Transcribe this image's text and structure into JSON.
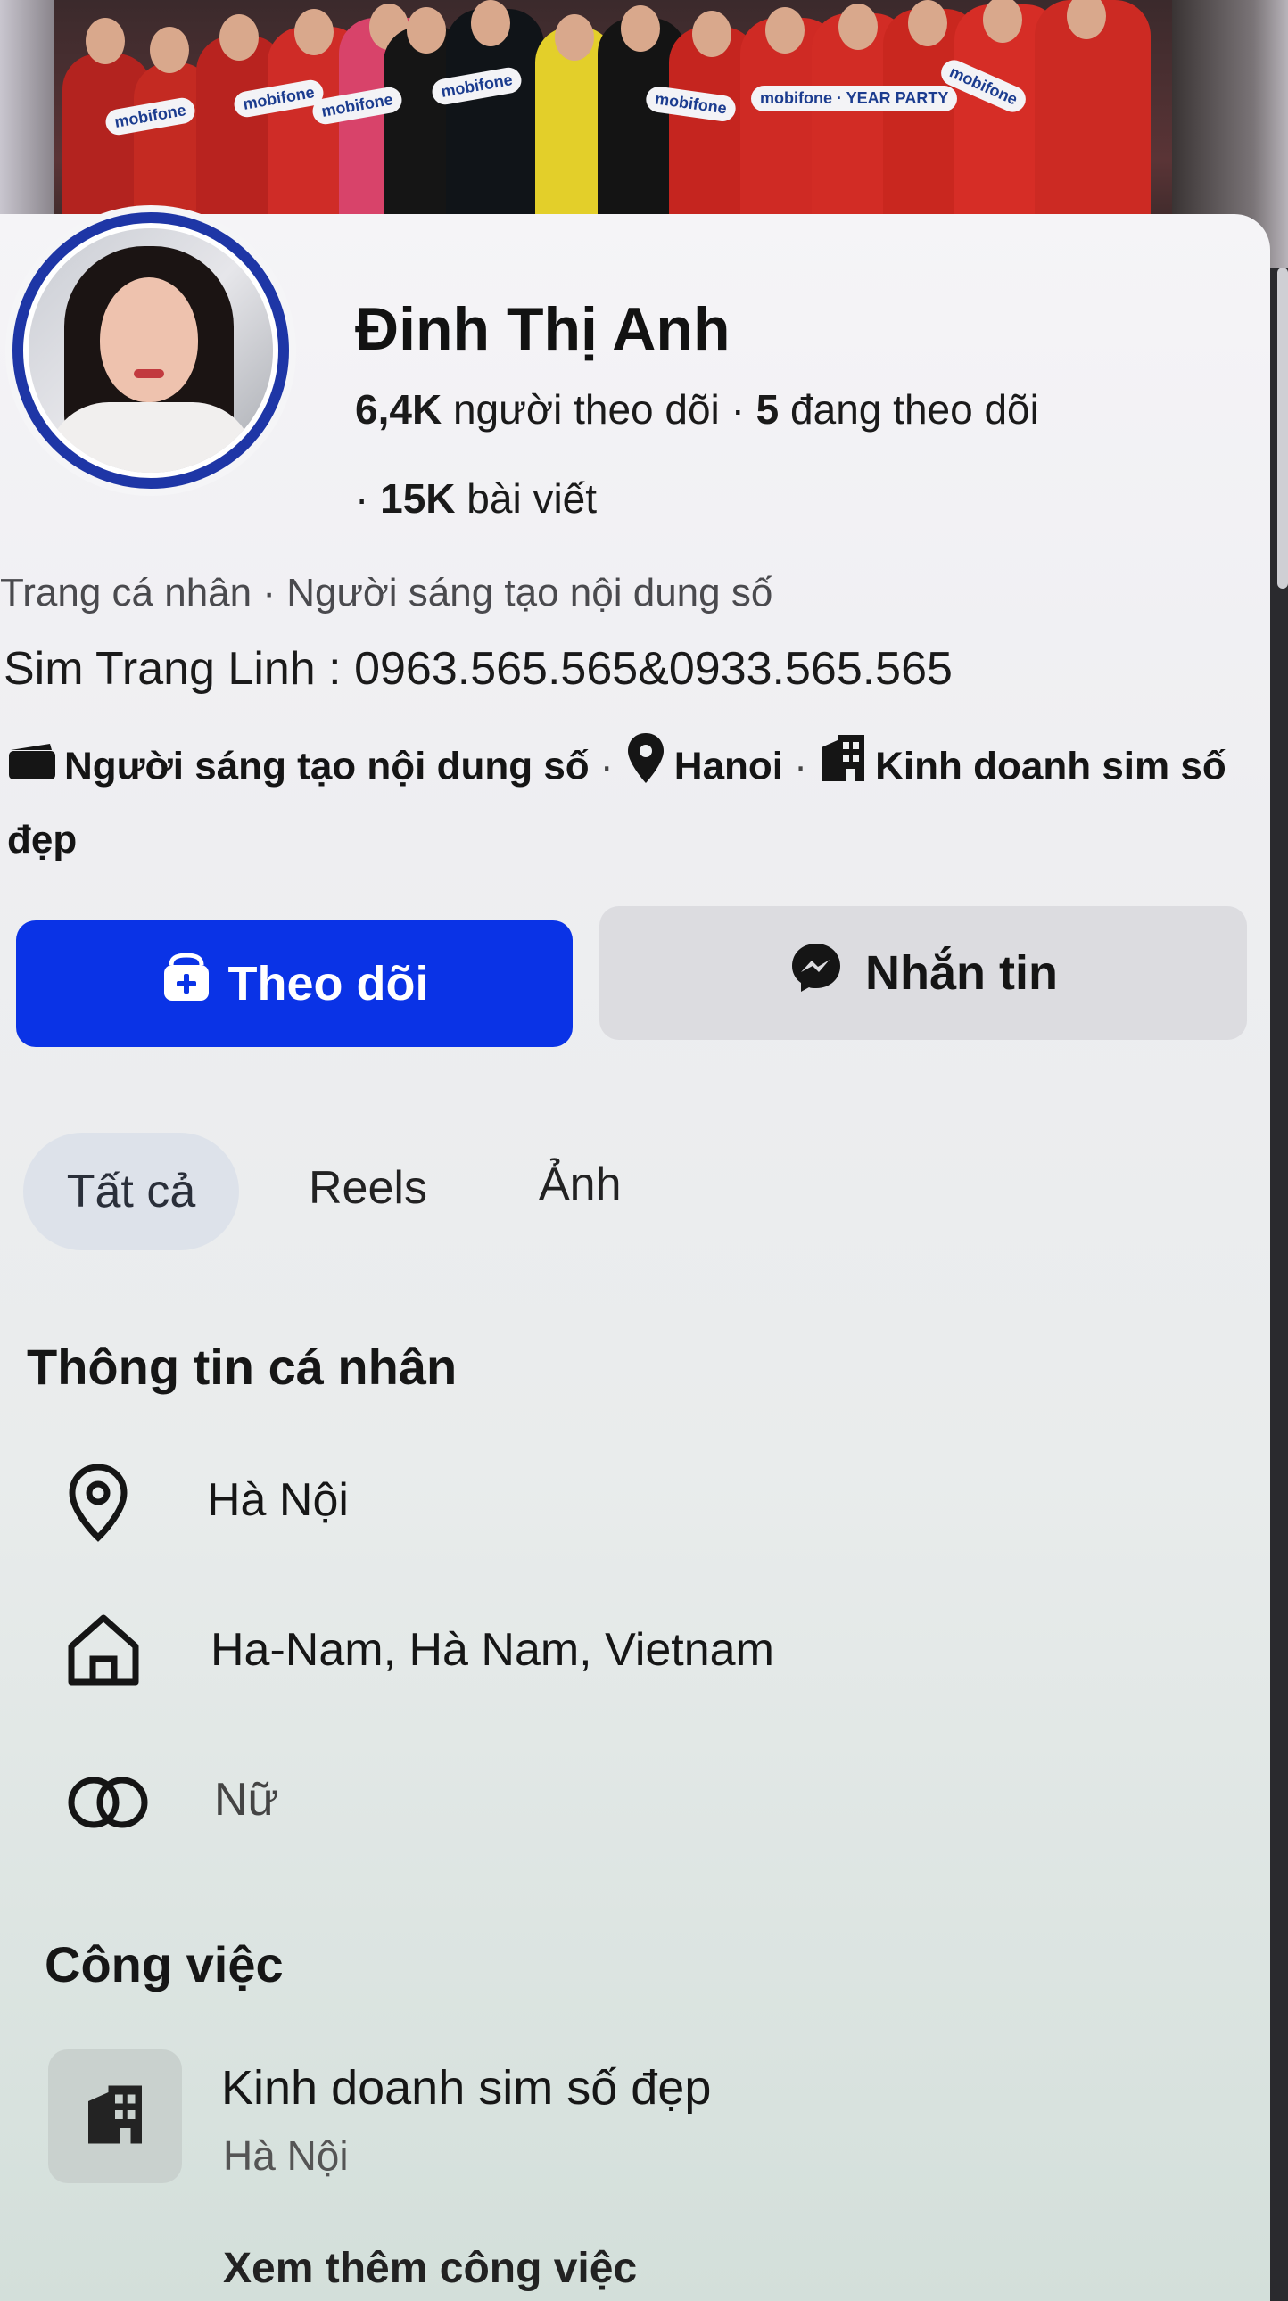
{
  "profile": {
    "name": "Đinh Thị Anh",
    "followers_count": "6,4K",
    "followers_label": "người theo dõi",
    "following_count": "5",
    "following_label": "đang theo dõi",
    "posts_count": "15K",
    "posts_label": "bài viết",
    "category": "Trang cá nhân · Người sáng tạo nội dung số",
    "bio": "Sim Trang Linh : 0963.565.565&0933.565.565",
    "detail_creator": "Người sáng tạo nội dung số",
    "detail_location": "Hanoi",
    "detail_business": "Kinh doanh sim số đẹp"
  },
  "cover": {
    "sign_text": "mobifone",
    "sign_text_party": "mobifone · YEAR PARTY"
  },
  "actions": {
    "follow_label": "Theo dõi",
    "message_label": "Nhắn tin"
  },
  "tabs": [
    {
      "label": "Tất cả",
      "active": true
    },
    {
      "label": "Reels",
      "active": false
    },
    {
      "label": "Ảnh",
      "active": false
    }
  ],
  "personal_info": {
    "title": "Thông tin cá nhân",
    "current_city": "Hà Nội",
    "hometown": "Ha-Nam, Hà Nam, Vietnam",
    "gender": "Nữ"
  },
  "work": {
    "title": "Công việc",
    "job_title": "Kinh doanh sim số đẹp",
    "job_location": "Hà Nội",
    "see_more": "Xem thêm công việc"
  },
  "colors": {
    "follow_button": "#0a33e6",
    "avatar_ring": "#1e36a6",
    "message_button": "#dcdce0"
  },
  "icons": {
    "follow": "add-friend-icon",
    "message": "messenger-icon",
    "creator": "clapperboard-icon",
    "location": "map-pin-icon",
    "business": "building-icon",
    "current_city": "location-outline-icon",
    "hometown": "house-icon",
    "gender": "gender-rings-icon",
    "work": "building-icon"
  }
}
